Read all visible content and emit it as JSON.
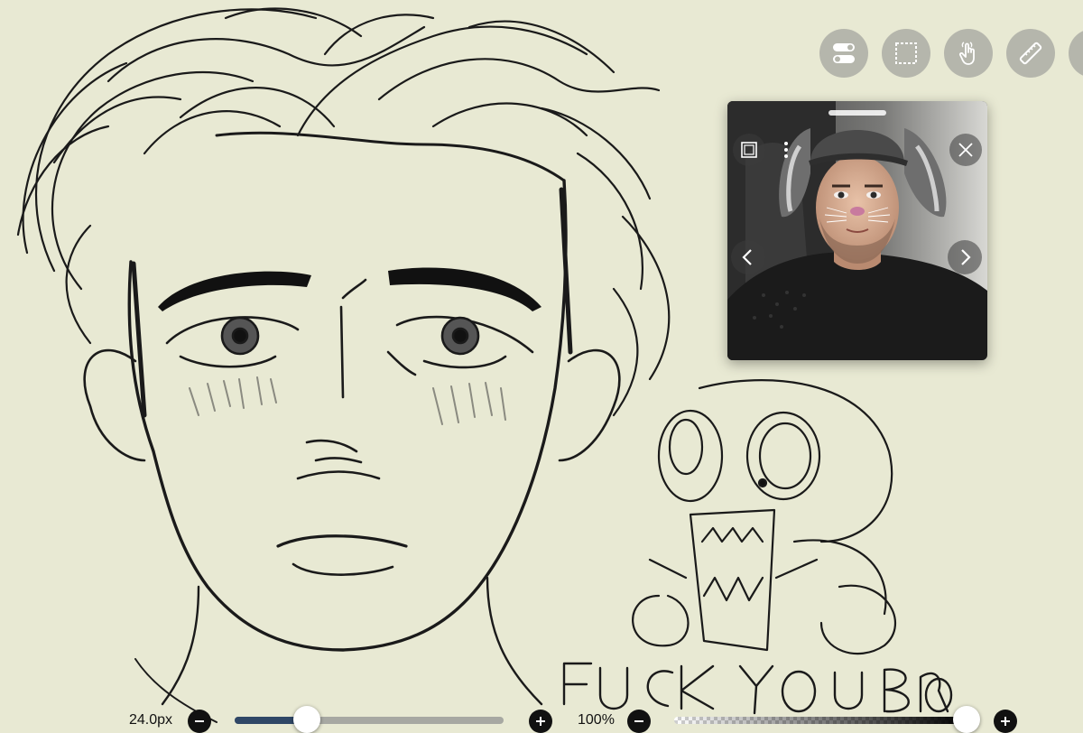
{
  "toolbar": {
    "tools": [
      {
        "name": "layers-toggle",
        "icon": "toggle-icon"
      },
      {
        "name": "selection",
        "icon": "marquee-selection-icon"
      },
      {
        "name": "gesture",
        "icon": "hand-pointer-icon"
      },
      {
        "name": "ruler",
        "icon": "ruler-icon"
      },
      {
        "name": "more",
        "icon": "phone-icon"
      }
    ]
  },
  "reference_window": {
    "icons": [
      "layer-square-icon",
      "more-vertical-icon",
      "close-icon",
      "chevron-left-icon",
      "chevron-right-icon"
    ]
  },
  "brush_size": {
    "label": "24.0px",
    "level": 0.27
  },
  "opacity": {
    "label": "100%",
    "level": 1.0
  },
  "colors": {
    "canvas": "#e8e9d3",
    "tool_button": "#b5b6ac",
    "size_fill": "#2f4766",
    "ink": "#111111"
  }
}
